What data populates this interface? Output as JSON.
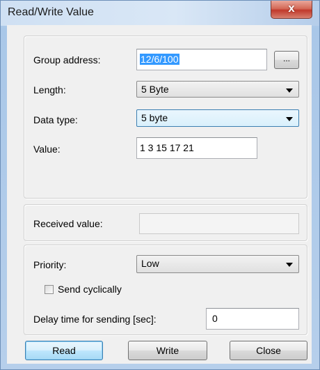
{
  "window": {
    "title": "Read/Write Value",
    "close_glyph": "x"
  },
  "target": {
    "group_address_label": "Group address:",
    "group_address_value": "12/6/100",
    "browse_button_label": "...",
    "length_label": "Length:",
    "length_value": "5 Byte",
    "data_type_label": "Data type:",
    "data_type_value": "5 byte",
    "value_label": "Value:",
    "value_value": "1 3 15 17 21"
  },
  "received": {
    "label": "Received value:",
    "value": ""
  },
  "options": {
    "priority_label": "Priority:",
    "priority_value": "Low",
    "send_cyclically_label": "Send cyclically",
    "send_cyclically_checked": false,
    "delay_label": "Delay time for sending [sec]:",
    "delay_value": "0"
  },
  "buttons": {
    "read": "Read",
    "write": "Write",
    "close": "Close"
  }
}
